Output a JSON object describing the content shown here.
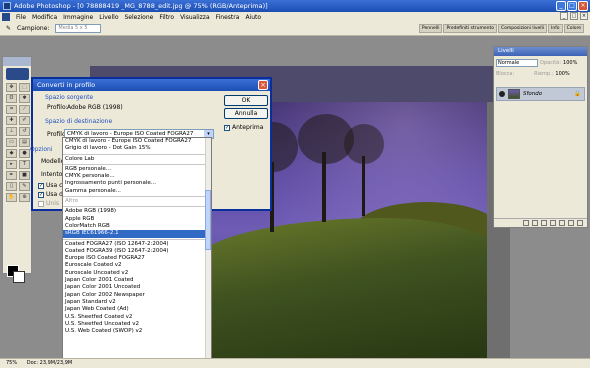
{
  "app": {
    "title": "Adobe Photoshop - [0 78888419 _MG_8788_edit.jpg @ 75% (RGB/Anteprima)]"
  },
  "menubar": {
    "items": [
      "File",
      "Modifica",
      "Immagine",
      "Livello",
      "Selezione",
      "Filtro",
      "Visualizza",
      "Finestra",
      "Aiuto"
    ]
  },
  "options_bar": {
    "sample_label": "Campione:",
    "sample_value": "Media 5 x 5",
    "palette_wells": [
      "Pennelli",
      "Predefiniti strumento",
      "Composizioni livelli",
      "Info",
      "Colore"
    ]
  },
  "dialog": {
    "title": "Converti in profilo",
    "source_section": "Spazio sorgente",
    "source_profile_label": "Profilo:",
    "source_profile_value": "Adobe RGB (1998)",
    "dest_section": "Spazio di destinazione",
    "dest_profile_label": "Profilo:",
    "dest_profile_value": "CMYK di lavoro - Europe ISO Coated FOGRA27",
    "options_section": "Opzioni",
    "engine_label": "Modello:",
    "intent_label": "Intento:",
    "use_bpc_label": "Usa co",
    "use_dither_label": "Usa dit",
    "flatten_label": "Unis",
    "ok_label": "OK",
    "cancel_label": "Annulla",
    "preview_label": "Anteprima"
  },
  "dropdown": {
    "items": [
      {
        "label": "CMYK di lavoro - Europe ISO Coated FOGRA27",
        "type": "option"
      },
      {
        "label": "Grigio di lavoro - Dot Gain 15%",
        "type": "option"
      },
      {
        "type": "sep"
      },
      {
        "label": "Colore Lab",
        "type": "option"
      },
      {
        "type": "sep"
      },
      {
        "label": "RGB personale...",
        "type": "option"
      },
      {
        "label": "CMYK personale...",
        "type": "option"
      },
      {
        "label": "Ingrossamento punti personale...",
        "type": "option"
      },
      {
        "label": "Gamma personale...",
        "type": "option"
      },
      {
        "type": "sep"
      },
      {
        "label": "Altro",
        "type": "group"
      },
      {
        "type": "sep"
      },
      {
        "label": "Adobe RGB (1998)",
        "type": "option"
      },
      {
        "label": "Apple RGB",
        "type": "option"
      },
      {
        "label": "ColorMatch RGB",
        "type": "option"
      },
      {
        "label": "sRGB IEC61966-2.1",
        "type": "selected"
      },
      {
        "type": "sep"
      },
      {
        "label": "Coated FOGRA27 (ISO 12647-2:2004)",
        "type": "option"
      },
      {
        "label": "Coated FOGRA39 (ISO 12647-2:2004)",
        "type": "option"
      },
      {
        "label": "Europe ISO Coated FOGRA27",
        "type": "option"
      },
      {
        "label": "Euroscale Coated v2",
        "type": "option"
      },
      {
        "label": "Euroscale Uncoated v2",
        "type": "option"
      },
      {
        "label": "Japan Color 2001 Coated",
        "type": "option"
      },
      {
        "label": "Japan Color 2001 Uncoated",
        "type": "option"
      },
      {
        "label": "Japan Color 2002 Newspaper",
        "type": "option"
      },
      {
        "label": "Japan Standard v2",
        "type": "option"
      },
      {
        "label": "Japan Web Coated (Ad)",
        "type": "option"
      },
      {
        "label": "U.S. Sheetfed Coated v2",
        "type": "option"
      },
      {
        "label": "U.S. Sheetfed Uncoated v2",
        "type": "option"
      },
      {
        "label": "U.S. Web Coated (SWOP) v2",
        "type": "option"
      }
    ]
  },
  "layers_panel": {
    "title": "Livelli",
    "blend_mode": "Normale",
    "opacity_label": "Opacità:",
    "opacity_value": "100%",
    "lock_label": "Blocca:",
    "fill_label": "Riemp.:",
    "fill_value": "100%",
    "layer_name": "Sfondo"
  },
  "status_bar": {
    "zoom": "75%",
    "doc": "Doc: 23,9M/23,9M"
  }
}
